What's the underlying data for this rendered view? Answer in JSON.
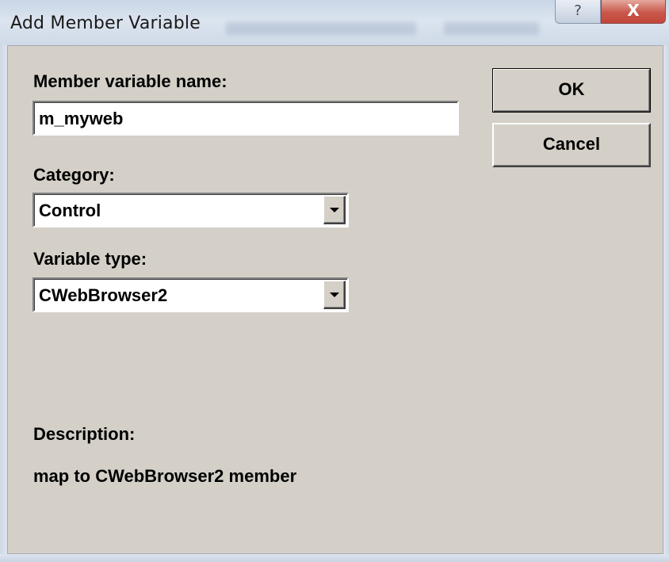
{
  "window": {
    "title": "Add Member Variable",
    "help_glyph": "?",
    "close_glyph": "X"
  },
  "form": {
    "name_label": "Member variable name:",
    "name_value": "m_myweb",
    "category_label": "Category:",
    "category_value": "Control",
    "type_label": "Variable type:",
    "type_value": "CWebBrowser2",
    "description_label": "Description:",
    "description_text": "map to CWebBrowser2 member"
  },
  "buttons": {
    "ok_label": "OK",
    "cancel_label": "Cancel"
  },
  "icons": {
    "help": "help-icon",
    "close": "close-icon",
    "dropdown": "chevron-down-icon"
  },
  "colors": {
    "dialog_face": "#d4d0c8",
    "close_button": "#c9574a",
    "titlebar": "#dbe4ef"
  }
}
